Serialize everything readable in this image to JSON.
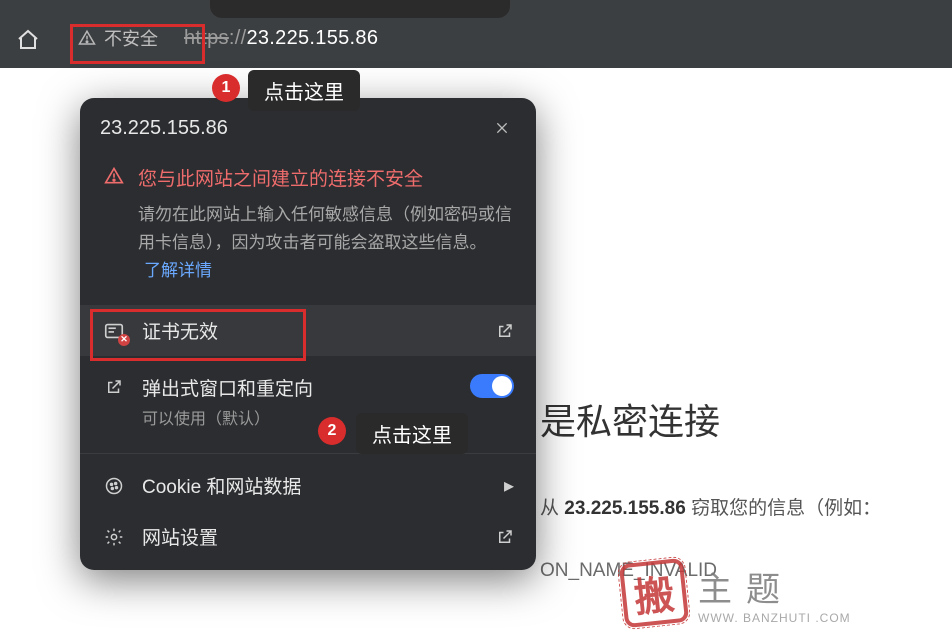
{
  "address_bar": {
    "not_secure_label": "不安全",
    "url_scheme": "https",
    "url_sep": "://",
    "url_host": "23.225.155.86"
  },
  "annotations": {
    "badge1": "1",
    "tooltip1": "点击这里",
    "badge2": "2",
    "tooltip2": "点击这里"
  },
  "popup": {
    "title": "23.225.155.86",
    "warning_heading": "您与此网站之间建立的连接不安全",
    "warning_body": "请勿在此网站上输入任何敏感信息（例如密码或信用卡信息），因为攻击者可能会盗取这些信息。",
    "warning_link": "了解详情",
    "cert_row_label": "证书无效",
    "popups_row_label": "弹出式窗口和重定向",
    "popups_row_sub": "可以使用（默认）",
    "cookies_row_label": "Cookie 和网站数据",
    "settings_row_label": "网站设置"
  },
  "page": {
    "heading_fragment": "是私密连接",
    "line2_prefix": "从 ",
    "line2_ip": "23.225.155.86",
    "line2_suffix": " 窃取您的信息（例如：",
    "error_code_fragment": "ON_NAME_INVALID"
  },
  "watermark": {
    "glyph": "搬",
    "main": "主题",
    "sub": "WWW. BANZHUTI .COM"
  }
}
